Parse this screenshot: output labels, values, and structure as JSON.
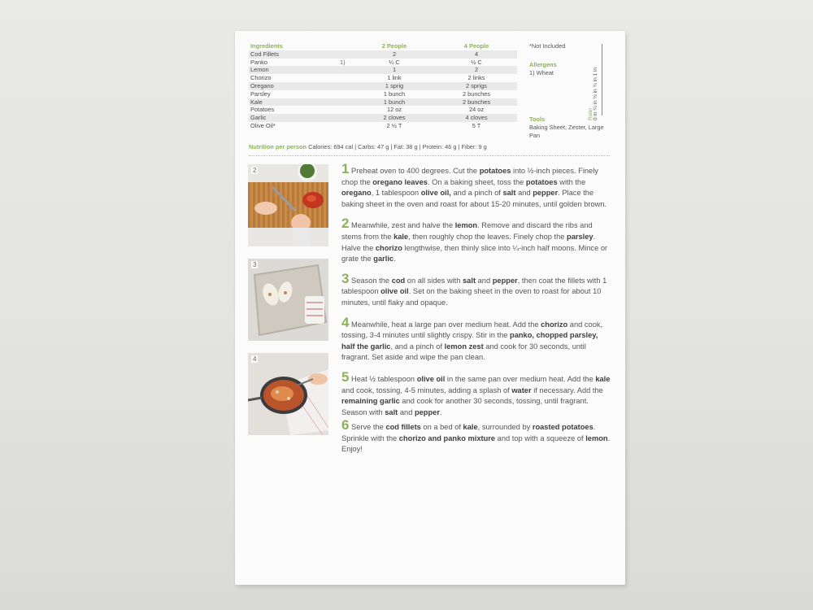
{
  "ingredients": {
    "header": {
      "name": "Ingredients",
      "col2": "2 People",
      "col4": "4 People"
    },
    "rows": [
      {
        "name": "Cod Fillets",
        "note": "",
        "two": "2",
        "four": "4"
      },
      {
        "name": "Panko",
        "note": "1)",
        "two": "¼ C",
        "four": "½ C"
      },
      {
        "name": "Lemon",
        "note": "",
        "two": "1",
        "four": "2"
      },
      {
        "name": "Chorizo",
        "note": "",
        "two": "1 link",
        "four": "2 links"
      },
      {
        "name": "Oregano",
        "note": "",
        "two": "1 sprig",
        "four": "2 sprigs"
      },
      {
        "name": "Parsley",
        "note": "",
        "two": "1 bunch",
        "four": "2 bunches"
      },
      {
        "name": "Kale",
        "note": "",
        "two": "1 bunch",
        "four": "2 bunches"
      },
      {
        "name": "Potatoes",
        "note": "",
        "two": "12 oz",
        "four": "24 oz"
      },
      {
        "name": "Garlic",
        "note": "",
        "two": "2 cloves",
        "four": "4 cloves"
      },
      {
        "name": "Olive Oil*",
        "note": "",
        "two": "2 ½ T",
        "four": "5 T"
      }
    ]
  },
  "not_included": "*Not Included",
  "allergens": {
    "title": "Allergens",
    "item": "1) Wheat"
  },
  "tools": {
    "title": "Tools",
    "text": "Baking Sheet, Zester, Large Pan"
  },
  "ruler": {
    "title": "Ruler",
    "scale": "0 in  ¼ in  ½ in  ¾ in  1 in"
  },
  "nutrition": {
    "label": "Nutrition per person",
    "text": "Calories: 694 cal | Carbs: 47 g | Fat: 38 g | Protein: 46 g | Fiber: 9 g"
  },
  "photos": [
    {
      "num": "2"
    },
    {
      "num": "3"
    },
    {
      "num": "4"
    }
  ],
  "steps": [
    {
      "n": "1",
      "html": "Preheat oven to 400 degrees. Cut the <b>potatoes</b> into ½-inch pieces. Finely chop the <b>oregano leaves</b>. On a baking sheet, toss the <b>potatoes</b> with the <b>oregano</b>, 1 tablespoon <b>olive oil,</b> and a pinch of <b>salt</b> and <b>pepper</b>. Place the baking sheet in the oven and roast for about 15-20 minutes, until golden brown."
    },
    {
      "n": "2",
      "html": "Meanwhile, zest and halve the <b>lemon</b>. Remove and discard the ribs and stems from the <b>kale</b>, then roughly chop the leaves. Finely chop the <b>parsley</b>. Halve the <b>chorizo</b> lengthwise, then thinly slice into ¼-inch half moons. Mince or grate the <b>garlic</b>."
    },
    {
      "n": "3",
      "html": "Season the <b>cod</b> on all sides with <b>salt</b> and <b>pepper</b>, then coat the fillets with 1 tablespoon <b>olive oil</b>. Set on the baking sheet in the oven to roast for about 10 minutes, until flaky and opaque."
    },
    {
      "n": "4",
      "html": "Meanwhile, heat a large pan over medium heat. Add the <b>chorizo</b> and cook, tossing, 3-4 minutes until slightly crispy. Stir in the <b>panko, chopped parsley, half the garlic</b>, and a pinch of <b>lemon zest</b> and cook for 30 seconds, until fragrant. Set aside and wipe the pan clean."
    },
    {
      "n": "5",
      "html": "Heat ½ tablespoon <b>olive oil</b> in the same pan over medium heat. Add the <b>kale</b> and cook, tossing, 4-5 minutes, adding a splash of <b>water</b> if necessary. Add the <b>remaining garlic</b> and cook for another 30 seconds, tossing, until fragrant. Season with <b>salt</b> and <b>pepper</b>."
    },
    {
      "n": "6",
      "html": "Serve the <b>cod fillets</b> on a bed of <b>kale</b>, surrounded by <b>roasted potatoes</b>. Sprinkle with the <b>chorizo and panko mixture</b> and top with a squeeze of <b>lemon</b>. Enjoy!"
    }
  ],
  "colors": {
    "accent": "#8db15a",
    "text": "#555555",
    "card": "#fbfbfb",
    "background": "#e6e6e3"
  }
}
